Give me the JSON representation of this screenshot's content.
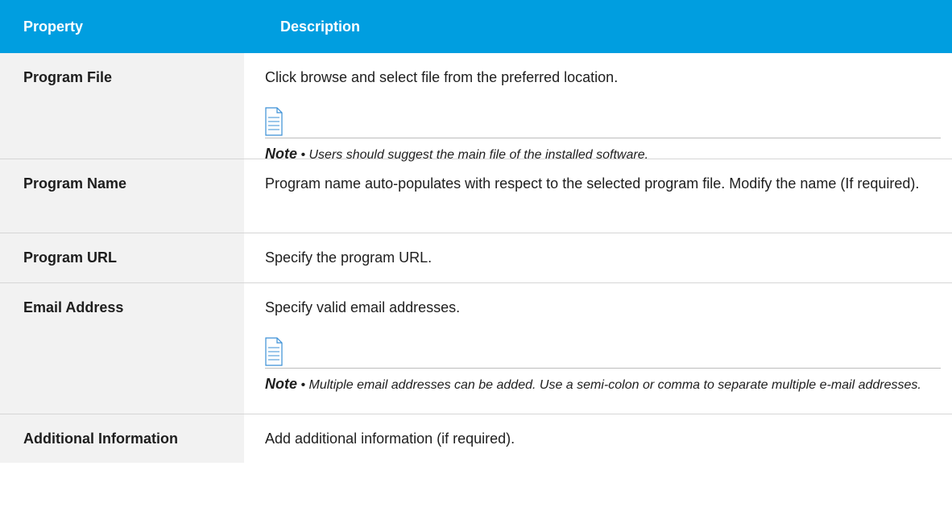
{
  "table": {
    "headers": {
      "property": "Property",
      "description": "Description"
    },
    "rows": [
      {
        "property": "Program File",
        "description": "Click browse and select file from the preferred location.",
        "note_label": "Note",
        "note_text": "• Users should suggest the main file of the installed software."
      },
      {
        "property": "Program Name",
        "description": "Program name auto-populates with respect to the selected program file. Modify the name (If required)."
      },
      {
        "property": "Program URL",
        "description": "Specify the program URL."
      },
      {
        "property": "Email Address",
        "description": "Specify valid email addresses.",
        "note_label": "Note",
        "note_text": "• Multiple email addresses can be added. Use a semi-colon or comma to separate multiple e-mail addresses."
      },
      {
        "property": "Additional Information",
        "description": "Add additional information (if required)."
      }
    ]
  },
  "colors": {
    "header_bg": "#009ee0",
    "property_col_bg": "#f2f2f2",
    "note_icon": "#3a8fd6"
  },
  "icons": {
    "note": "document-note-icon"
  }
}
